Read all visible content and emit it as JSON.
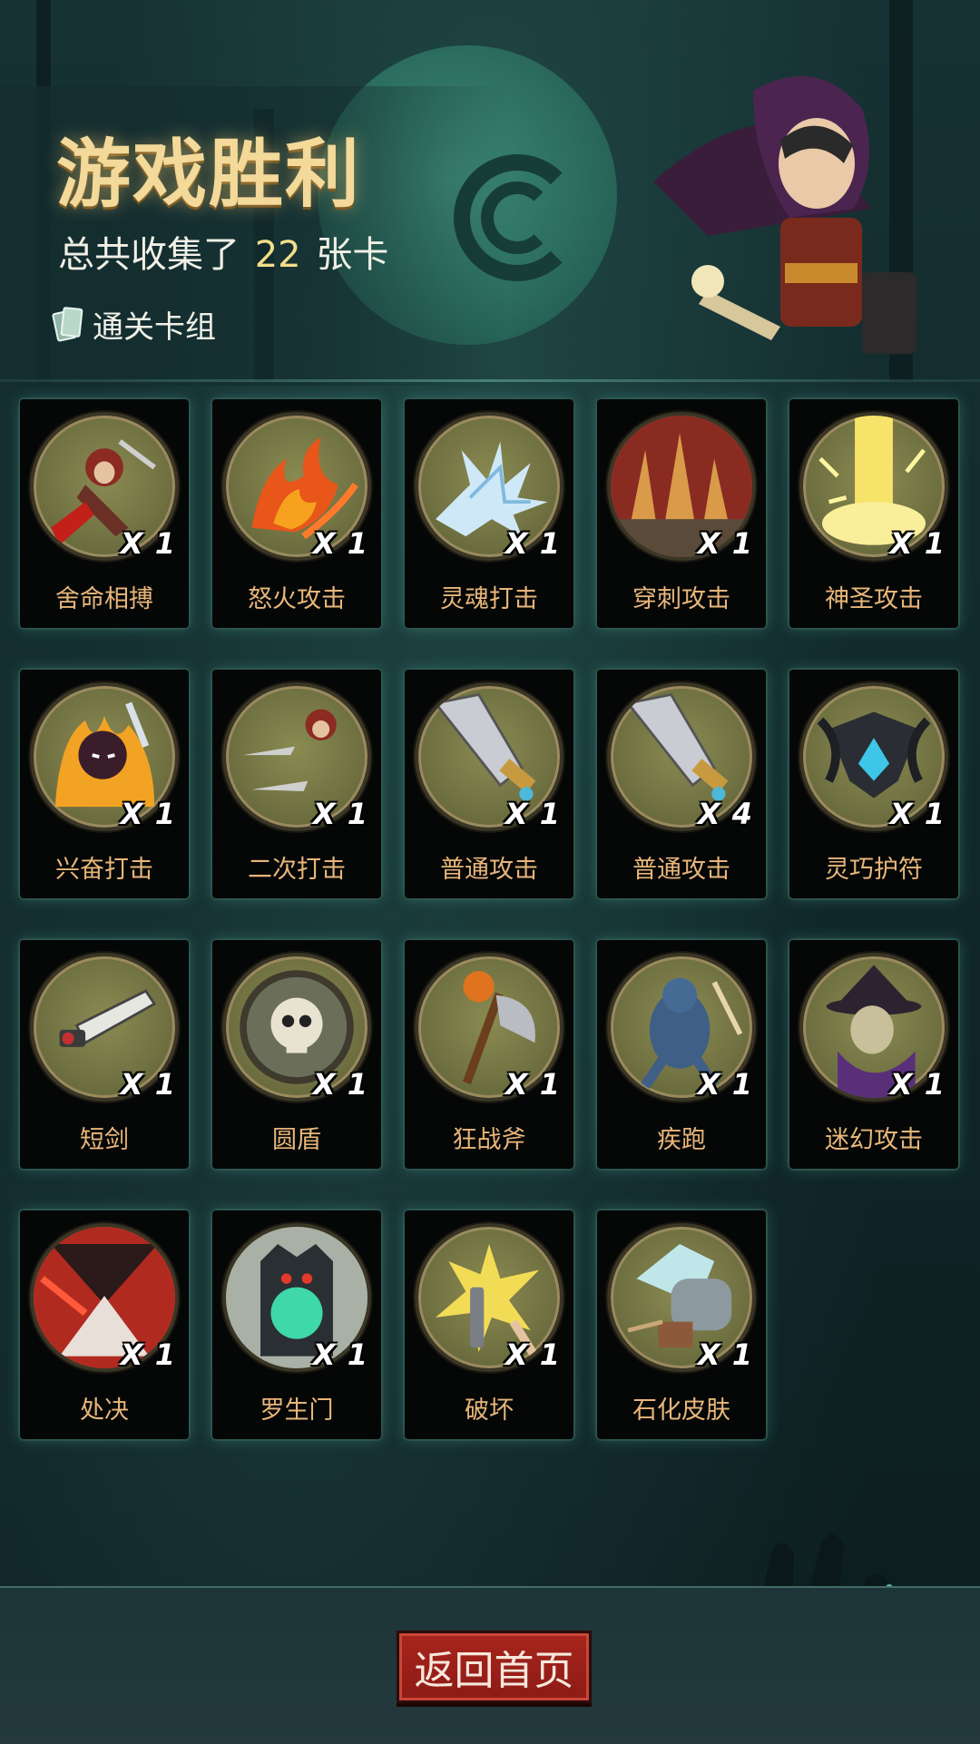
{
  "header": {
    "title": "游戏胜利",
    "subtitle_prefix": "总共收集了",
    "card_count": "22",
    "subtitle_suffix": "张卡",
    "deck_label": "通关卡组"
  },
  "cards": [
    {
      "name": "舍命相搏",
      "qty": "X 1",
      "icon": "hooded-warrior-bleeding-icon"
    },
    {
      "name": "怒火攻击",
      "qty": "X 1",
      "icon": "fire-slash-icon"
    },
    {
      "name": "灵魂打击",
      "qty": "X 1",
      "icon": "ice-crystals-icon"
    },
    {
      "name": "穿刺攻击",
      "qty": "X 1",
      "icon": "ground-spikes-icon"
    },
    {
      "name": "神圣攻击",
      "qty": "X 1",
      "icon": "holy-light-beam-icon"
    },
    {
      "name": "兴奋打击",
      "qty": "X 1",
      "icon": "flaming-hooded-figure-icon"
    },
    {
      "name": "二次打击",
      "qty": "X 1",
      "icon": "double-dagger-throw-icon"
    },
    {
      "name": "普通攻击",
      "qty": "X 1",
      "icon": "sword-icon"
    },
    {
      "name": "普通攻击",
      "qty": "X 4",
      "icon": "sword-icon"
    },
    {
      "name": "灵巧护符",
      "qty": "X 1",
      "icon": "amulet-icon"
    },
    {
      "name": "短剑",
      "qty": "X 1",
      "icon": "short-sword-icon"
    },
    {
      "name": "圆盾",
      "qty": "X 1",
      "icon": "skull-shield-icon"
    },
    {
      "name": "狂战斧",
      "qty": "X 1",
      "icon": "pumpkin-axe-icon"
    },
    {
      "name": "疾跑",
      "qty": "X 1",
      "icon": "running-werewolf-icon"
    },
    {
      "name": "迷幻攻击",
      "qty": "X 1",
      "icon": "witch-icon"
    },
    {
      "name": "处决",
      "qty": "X 1",
      "icon": "execution-icon"
    },
    {
      "name": "罗生门",
      "qty": "X 1",
      "icon": "demon-gate-icon"
    },
    {
      "name": "破坏",
      "qty": "X 1",
      "icon": "shatter-icon"
    },
    {
      "name": "石化皮肤",
      "qty": "X 1",
      "icon": "stone-fist-icon"
    }
  ],
  "footer": {
    "home_button": "返回首页"
  },
  "colors": {
    "title": "#f3d99a",
    "card_name": "#e8b67a",
    "medal_bg": "#727343",
    "button_red": "#a8251d"
  }
}
